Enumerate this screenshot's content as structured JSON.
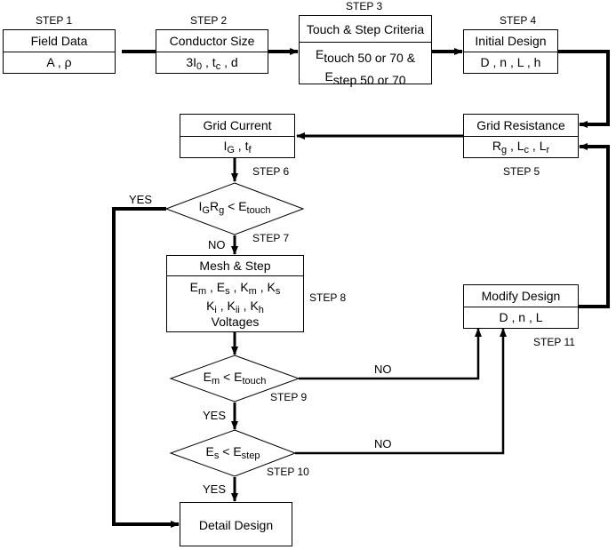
{
  "steps": {
    "s1": "STEP 1",
    "s2": "STEP 2",
    "s3": "STEP 3",
    "s4": "STEP 4",
    "s5": "STEP 5",
    "s6": "STEP 6",
    "s7": "STEP 7",
    "s8": "STEP 8",
    "s9": "STEP 9",
    "s10": "STEP 10",
    "s11": "STEP 11"
  },
  "boxes": {
    "field_data": {
      "title": "Field Data",
      "body": "A , ρ"
    },
    "conductor_size": {
      "title": "Conductor Size",
      "b1": "3I",
      "b1s": "0",
      "b2": " ,  t",
      "b2s": "c",
      "b3": " ,  d"
    },
    "touch_step": {
      "title": "Touch & Step  Criteria",
      "l1a": "E",
      "l1s": "touch",
      "l1b": " 50  or  70  &",
      "l2a": "E",
      "l2s": "step",
      "l2b": " 50  or  70"
    },
    "initial_design": {
      "title": "Initial  Design",
      "body": "D ,  n ,  L ,  h"
    },
    "grid_resistance": {
      "title": "Grid  Resistance",
      "a": "R",
      "as": "g",
      "b": " ,  L",
      "bs": "c",
      "c": " ,  L",
      "cs": "r"
    },
    "grid_current": {
      "title": "Grid  Current",
      "a": "I",
      "as": "G",
      "b": " ,  t",
      "bs": "f"
    },
    "mesh_step": {
      "title": "Mesh  &  Step",
      "r1": "E",
      "r1s": "m",
      "r2": " ,  E",
      "r2s": "s",
      "r3": " ,  K",
      "r3s": "m",
      "r4": " ,  K",
      "r4s": "s",
      "k1": "K",
      "k1s": "i",
      "k2": " ,  K",
      "k2s": "ii",
      "k3": " ,  K",
      "k3s": "h",
      "r3line": "Voltages"
    },
    "modify_design": {
      "title": "Modify  Design",
      "body": "D ,  n ,  L"
    },
    "detail_design": {
      "title": "Detail  Design"
    }
  },
  "decisions": {
    "d7": {
      "a": "I",
      "as": "G",
      "b": "R",
      "bs": "g",
      "c": "  <  E",
      "cs": "touch"
    },
    "d9": {
      "a": "E",
      "as": "m",
      "b": "  <  E",
      "bs": "touch"
    },
    "d10": {
      "a": "E",
      "as": "s",
      "b": "  <  E",
      "bs": "step"
    }
  },
  "branch_labels": {
    "yes7": "YES",
    "no7": "NO",
    "yes9": "YES",
    "no9": "NO",
    "yes10": "YES",
    "no10": "NO"
  }
}
